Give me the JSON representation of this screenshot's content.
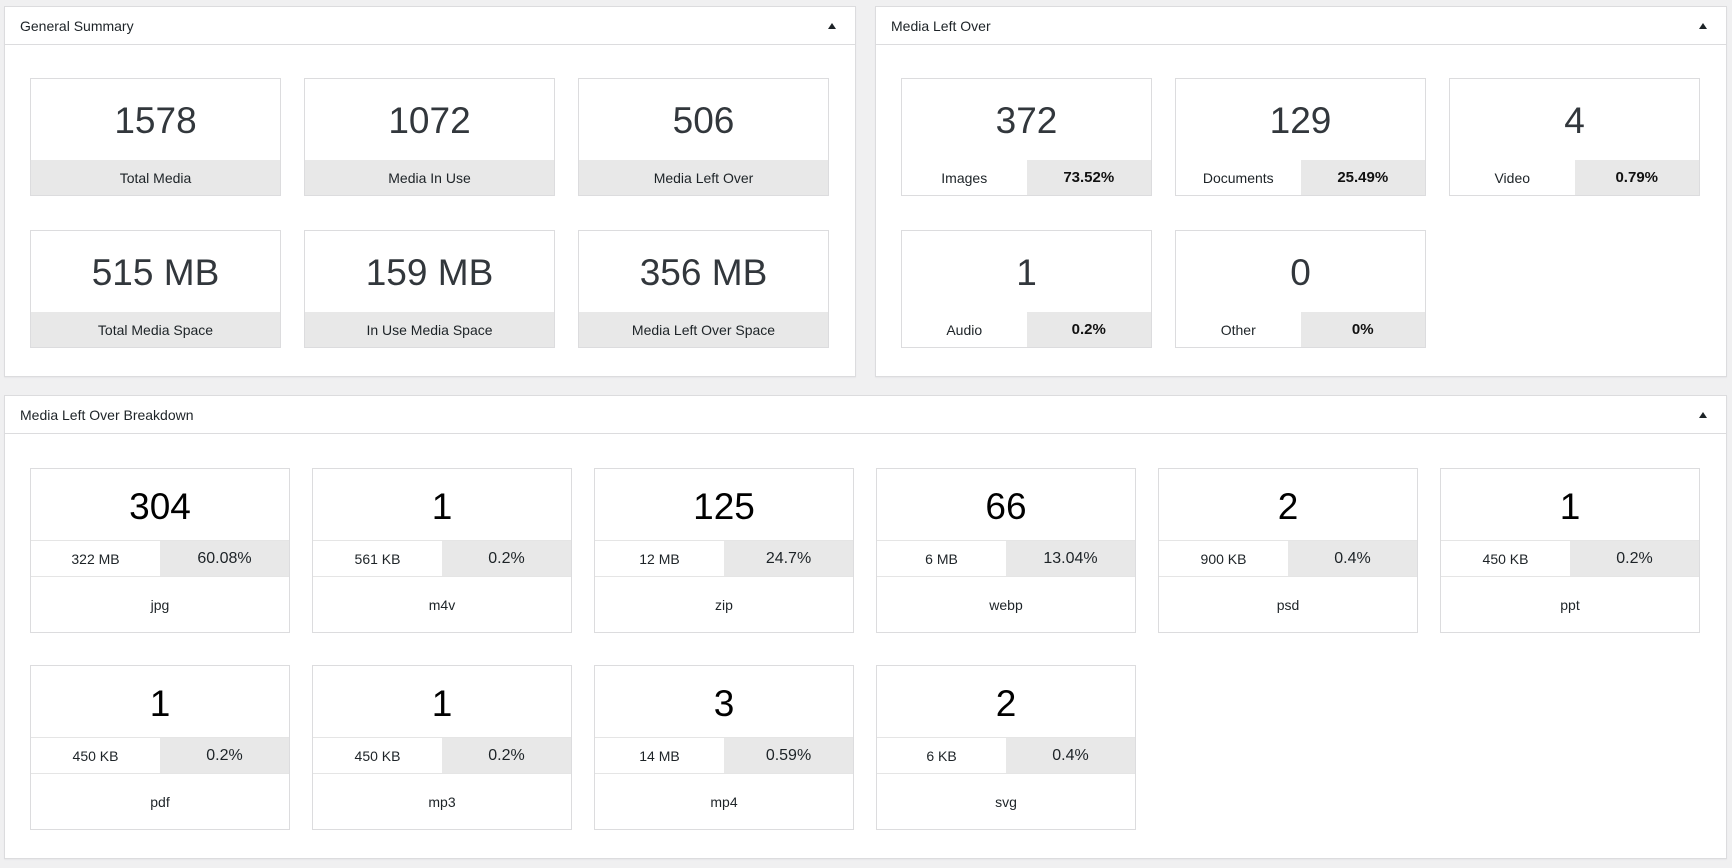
{
  "general_summary": {
    "title": "General Summary",
    "toggle_icon": "triangle-up-icon",
    "stats": [
      {
        "value": "1578",
        "label": "Total Media"
      },
      {
        "value": "1072",
        "label": "Media In Use"
      },
      {
        "value": "506",
        "label": "Media Left Over"
      },
      {
        "value": "515 MB",
        "label": "Total Media Space"
      },
      {
        "value": "159 MB",
        "label": "In Use Media Space"
      },
      {
        "value": "356 MB",
        "label": "Media Left Over Space"
      }
    ]
  },
  "media_left_over": {
    "title": "Media Left Over",
    "toggle_icon": "triangle-up-icon",
    "stats": [
      {
        "value": "372",
        "label": "Images",
        "percent": "73.52%"
      },
      {
        "value": "129",
        "label": "Documents",
        "percent": "25.49%"
      },
      {
        "value": "4",
        "label": "Video",
        "percent": "0.79%"
      },
      {
        "value": "1",
        "label": "Audio",
        "percent": "0.2%"
      },
      {
        "value": "0",
        "label": "Other",
        "percent": "0%"
      }
    ]
  },
  "breakdown": {
    "title": "Media Left Over Breakdown",
    "toggle_icon": "triangle-up-icon",
    "items": [
      {
        "count": "304",
        "size": "322 MB",
        "percent": "60.08%",
        "ext": "jpg"
      },
      {
        "count": "1",
        "size": "561 KB",
        "percent": "0.2%",
        "ext": "m4v"
      },
      {
        "count": "125",
        "size": "12 MB",
        "percent": "24.7%",
        "ext": "zip"
      },
      {
        "count": "66",
        "size": "6 MB",
        "percent": "13.04%",
        "ext": "webp"
      },
      {
        "count": "2",
        "size": "900 KB",
        "percent": "0.4%",
        "ext": "psd"
      },
      {
        "count": "1",
        "size": "450 KB",
        "percent": "0.2%",
        "ext": "ppt"
      },
      {
        "count": "1",
        "size": "450 KB",
        "percent": "0.2%",
        "ext": "pdf"
      },
      {
        "count": "1",
        "size": "450 KB",
        "percent": "0.2%",
        "ext": "mp3"
      },
      {
        "count": "3",
        "size": "14 MB",
        "percent": "0.59%",
        "ext": "mp4"
      },
      {
        "count": "2",
        "size": "6 KB",
        "percent": "0.4%",
        "ext": "svg"
      }
    ]
  }
}
